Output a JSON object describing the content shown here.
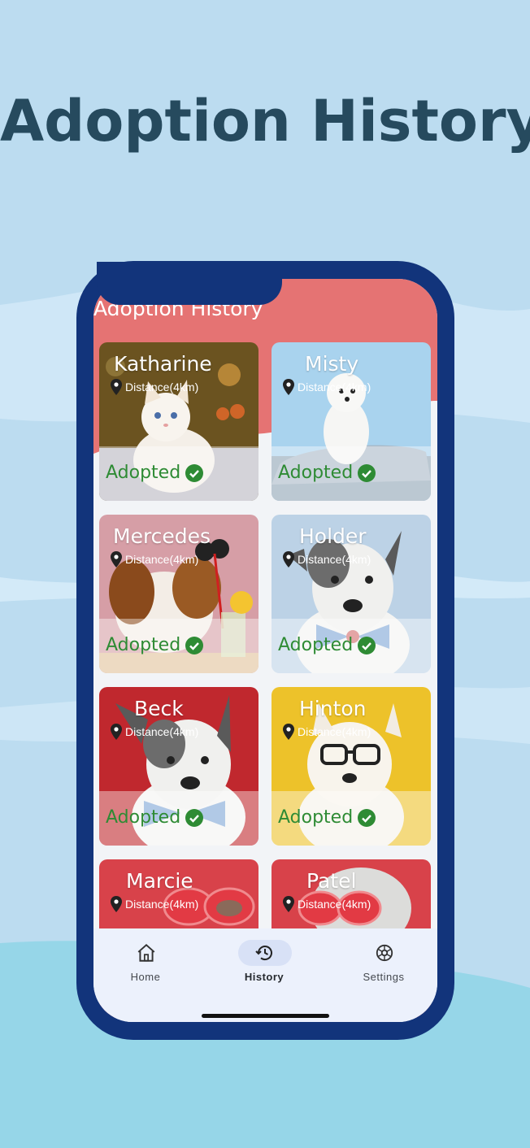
{
  "promo": {
    "headline": "Adoption History"
  },
  "app": {
    "title": "Adoption History",
    "cards": [
      {
        "name": "Katharine",
        "distance": "Distance(4km)",
        "status": "Adopted"
      },
      {
        "name": "Misty",
        "distance": "Distance(4km)",
        "status": "Adopted"
      },
      {
        "name": "Mercedes",
        "distance": "Distance(4km)",
        "status": "Adopted"
      },
      {
        "name": "Holder",
        "distance": "Distance(4km)",
        "status": "Adopted"
      },
      {
        "name": "Beck",
        "distance": "Distance(4km)",
        "status": "Adopted"
      },
      {
        "name": "Hinton",
        "distance": "Distance(4km)",
        "status": "Adopted"
      },
      {
        "name": "Marcie",
        "distance": "Distance(4km)",
        "status": ""
      },
      {
        "name": "Patel",
        "distance": "Distance(4km)",
        "status": ""
      }
    ],
    "nav": [
      {
        "label": "Home",
        "icon": "home-icon",
        "active": false
      },
      {
        "label": "History",
        "icon": "history-icon",
        "active": true
      },
      {
        "label": "Settings",
        "icon": "settings-icon",
        "active": false
      }
    ]
  },
  "colors": {
    "background": "#bcdcf0",
    "headline": "#264a5e",
    "phone_frame": "#12347b",
    "header": "#e57373",
    "adopted_green": "#2e8b34",
    "nav_background": "#ecf1fc",
    "nav_active_pill": "#d8e1f6"
  }
}
